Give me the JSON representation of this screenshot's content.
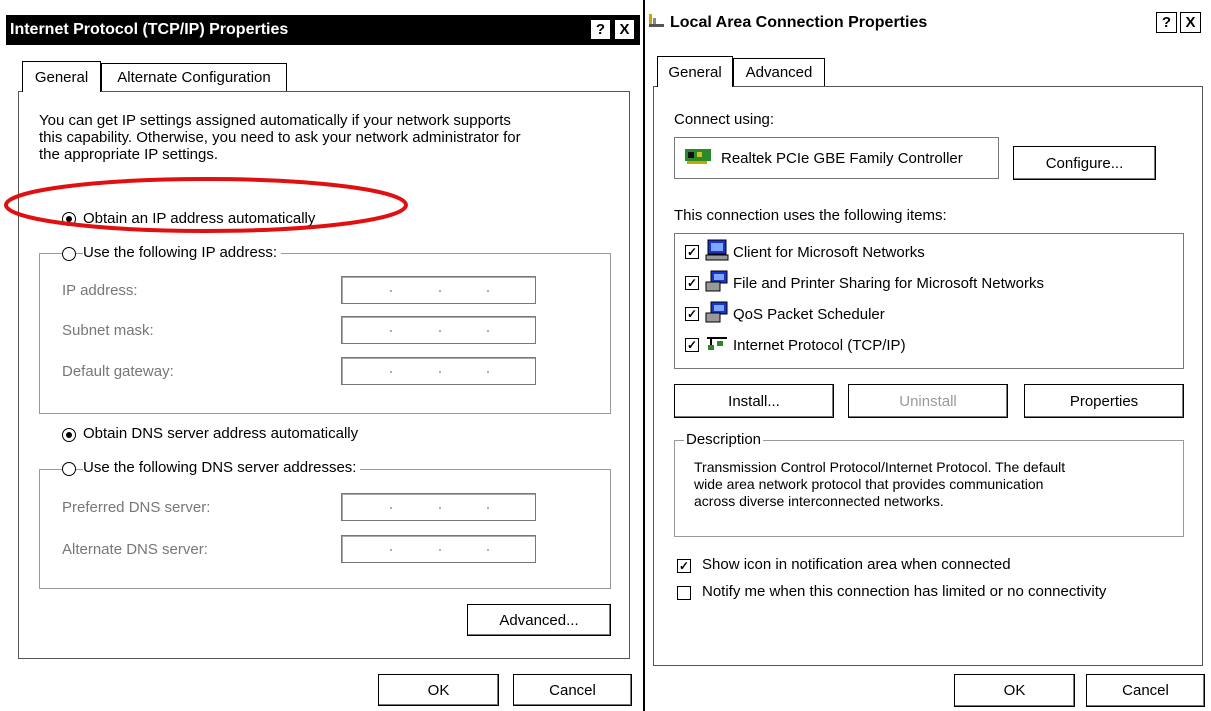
{
  "tcpip_dialog": {
    "title": "Internet Protocol (TCP/IP) Properties",
    "help_label": "?",
    "close_label": "X",
    "tabs": [
      {
        "label": "General"
      },
      {
        "label": "Alternate Configuration"
      }
    ],
    "intro": [
      "You can get IP settings assigned automatically if your network supports",
      "this capability. Otherwise, you need to ask your network administrator for",
      "the appropriate IP settings."
    ],
    "obtain_ip_auto": {
      "label": "Obtain an IP address automatically",
      "checked": true
    },
    "use_ip": {
      "label": "Use the following IP address:",
      "checked": false
    },
    "ip_fields": [
      {
        "label": "IP address:"
      },
      {
        "label": "Subnet mask:"
      },
      {
        "label": "Default gateway:"
      }
    ],
    "obtain_dns_auto": {
      "label": "Obtain DNS server address automatically",
      "checked": true
    },
    "use_dns": {
      "label": "Use the following DNS server addresses:",
      "checked": false
    },
    "dns_fields": [
      {
        "label": "Preferred DNS server:"
      },
      {
        "label": "Alternate DNS server:"
      }
    ],
    "advanced_label": "Advanced...",
    "ok_label": "OK",
    "cancel_label": "Cancel",
    "highlight_color": "#e01010"
  },
  "lan_dialog": {
    "title": "Local Area Connection Properties",
    "help_label": "?",
    "close_label": "X",
    "tabs": [
      {
        "label": "General"
      },
      {
        "label": "Advanced"
      }
    ],
    "connect_using_label": "Connect using:",
    "adapter_name": "Realtek PCIe GBE Family Controller",
    "configure_label": "Configure...",
    "items_label": "This connection uses the following items:",
    "items": [
      {
        "label": "Client for Microsoft Networks",
        "checked": true,
        "icon": "network-client-icon"
      },
      {
        "label": "File and Printer Sharing for Microsoft Networks",
        "checked": true,
        "icon": "network-service-icon"
      },
      {
        "label": "QoS Packet Scheduler",
        "checked": true,
        "icon": "network-service-icon"
      },
      {
        "label": "Internet Protocol (TCP/IP)",
        "checked": true,
        "icon": "network-protocol-icon"
      }
    ],
    "install_label": "Install...",
    "uninstall_label": "Uninstall",
    "properties_label": "Properties",
    "description_label": "Description",
    "description_lines": [
      "Transmission Control Protocol/Internet Protocol. The default",
      "wide area network protocol that provides communication",
      "across diverse interconnected networks."
    ],
    "show_icon": {
      "label": "Show icon in notification area when connected",
      "checked": true
    },
    "notify": {
      "label": "Notify me when this connection has limited or no connectivity",
      "checked": false
    },
    "ok_label": "OK",
    "cancel_label": "Cancel"
  }
}
